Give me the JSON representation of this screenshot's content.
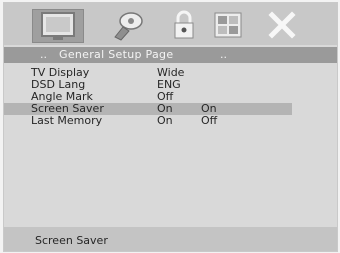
{
  "toolbar": {
    "icons": [
      {
        "name": "general-setup-icon",
        "selected": true
      },
      {
        "name": "audio-setup-icon",
        "selected": false
      },
      {
        "name": "lock-icon",
        "selected": false
      },
      {
        "name": "preference-icon",
        "selected": false
      },
      {
        "name": "exit-icon",
        "selected": false
      }
    ]
  },
  "page_bar": {
    "left_arrow": "..",
    "title": "General  Setup  Page",
    "right_arrow": ".."
  },
  "menu": {
    "rows": [
      {
        "label": "TV   Display",
        "value": "Wide",
        "option": ""
      },
      {
        "label": "DSD Lang",
        "value": "ENG",
        "option": ""
      },
      {
        "label": "Angle  Mark",
        "value": "Off",
        "option": ""
      },
      {
        "label": "Screen  Saver",
        "value": "On",
        "option": "On"
      },
      {
        "label": "Last  Memory",
        "value": "On",
        "option": "Off"
      }
    ]
  },
  "status": {
    "text": "Screen  Saver"
  },
  "colors": {
    "panel": "#d9d9d9",
    "page_bar": "#9a9a9a",
    "highlight": "#b4b4b4",
    "text": "#262626"
  }
}
